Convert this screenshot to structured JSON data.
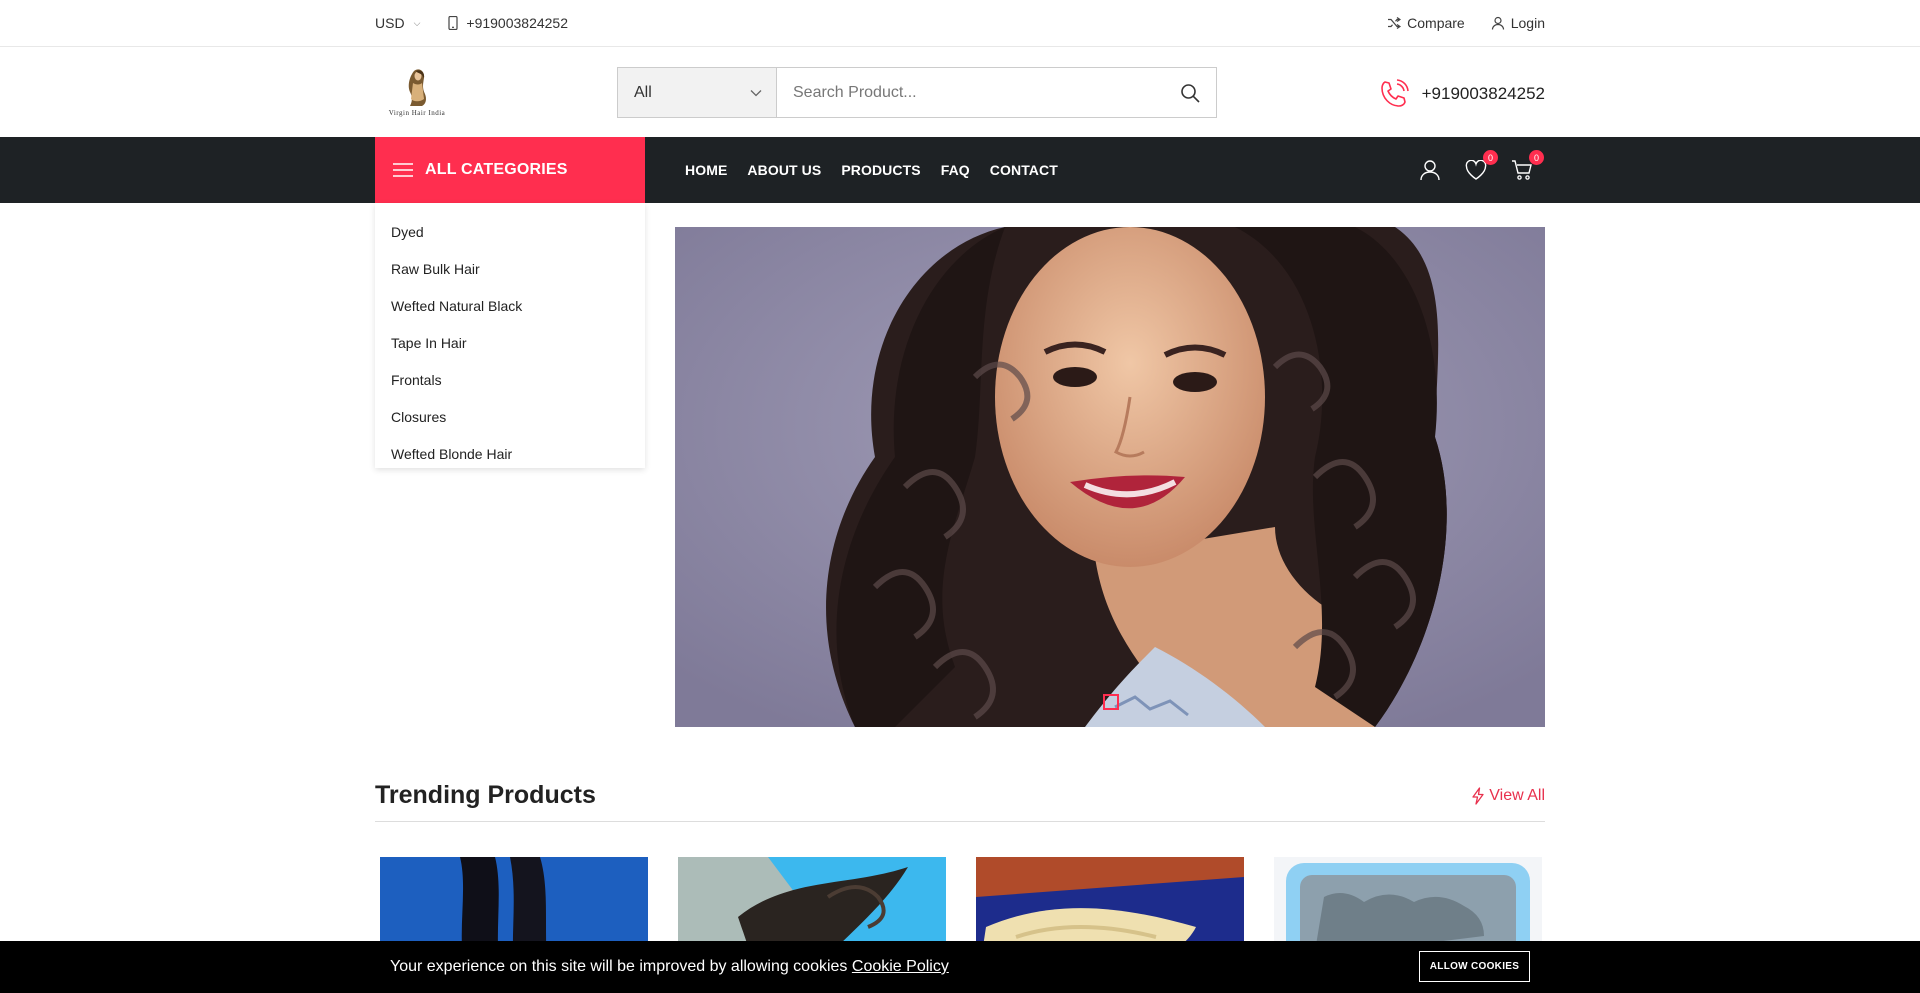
{
  "topbar": {
    "currency": "USD",
    "phone": "+919003824252",
    "compare_label": "Compare",
    "login_label": "Login"
  },
  "header": {
    "logo_text": "Virgin Hair India",
    "search": {
      "category_value": "All",
      "placeholder": "Search Product..."
    },
    "phone": "+919003824252"
  },
  "nav": {
    "all_categories_label": "ALL CATEGORIES",
    "menu": [
      "HOME",
      "ABOUT US",
      "PRODUCTS",
      "FAQ",
      "CONTACT"
    ],
    "wishlist_count": "0",
    "cart_count": "0"
  },
  "categories": [
    "Dyed",
    "Raw Bulk Hair",
    "Wefted Natural Black",
    "Tape In Hair",
    "Frontals",
    "Closures",
    "Wefted Blonde Hair"
  ],
  "trending": {
    "title": "Trending Products",
    "view_all_label": "View All"
  },
  "cookie": {
    "message": "Your experience on this site will be improved by allowing cookies",
    "policy_link": "Cookie Policy",
    "button_label": "ALLOW COOKIES"
  },
  "colors": {
    "accent": "#ff2e4f",
    "nav_bg": "#1e2225",
    "link_red": "#e8314d"
  }
}
